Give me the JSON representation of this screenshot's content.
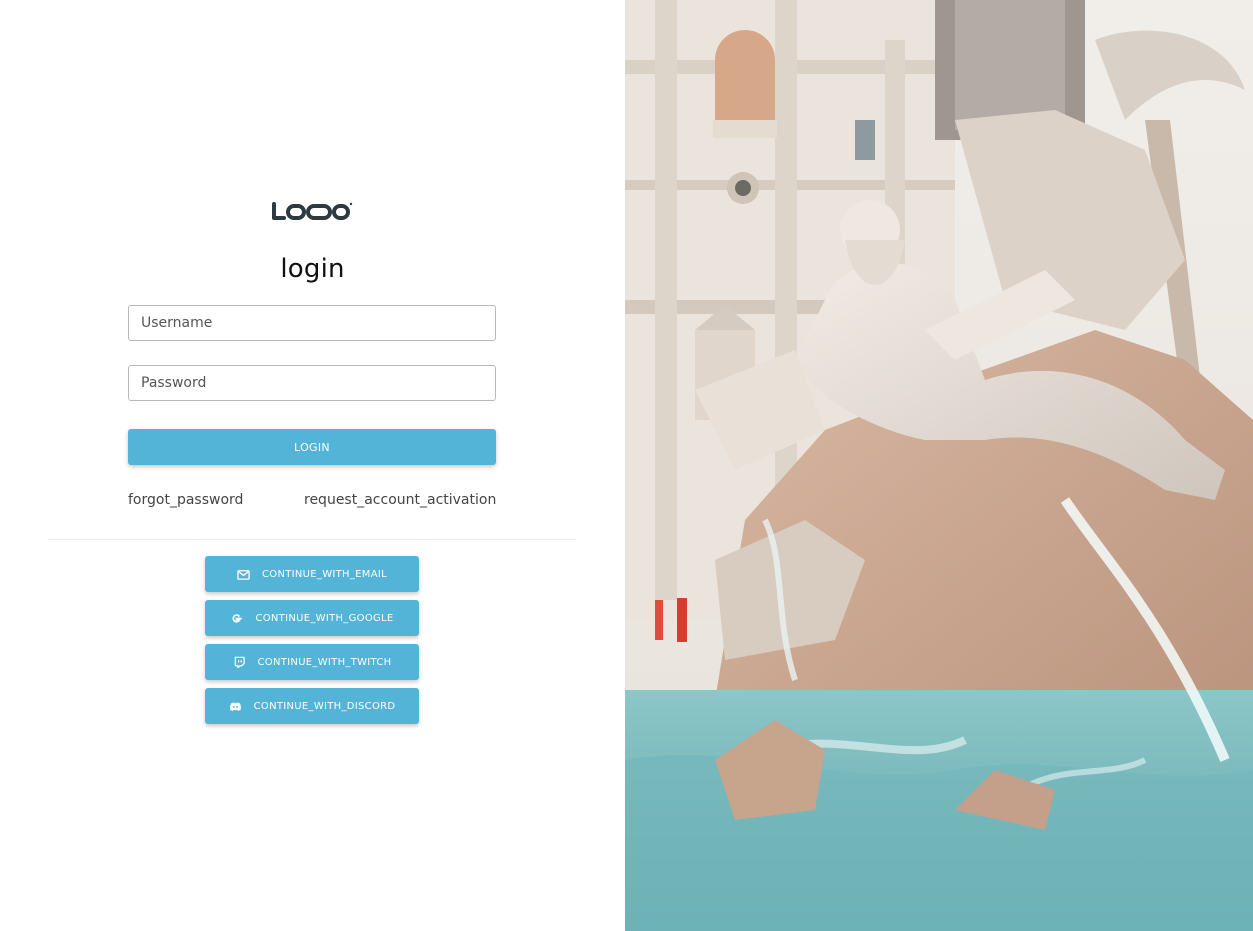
{
  "brand": {
    "logo_text": "LOOO",
    "accent_color": "#54b4d7"
  },
  "login_form": {
    "title": "login",
    "username_placeholder": "Username",
    "password_placeholder": "Password",
    "login_button": "LOGIN",
    "forgot_password_link": "forgot_password",
    "request_activation_link": "request_account_activation"
  },
  "social_login": [
    {
      "icon": "envelope-icon",
      "label": "CONTINUE_WITH_EMAIL"
    },
    {
      "icon": "google-icon",
      "label": "CONTINUE_WITH_GOOGLE"
    },
    {
      "icon": "twitch-icon",
      "label": "CONTINUE_WITH_TWITCH"
    },
    {
      "icon": "discord-icon",
      "label": "CONTINUE_WITH_DISCORD"
    }
  ],
  "hero_image": {
    "subject": "fountain-statue-photo"
  }
}
